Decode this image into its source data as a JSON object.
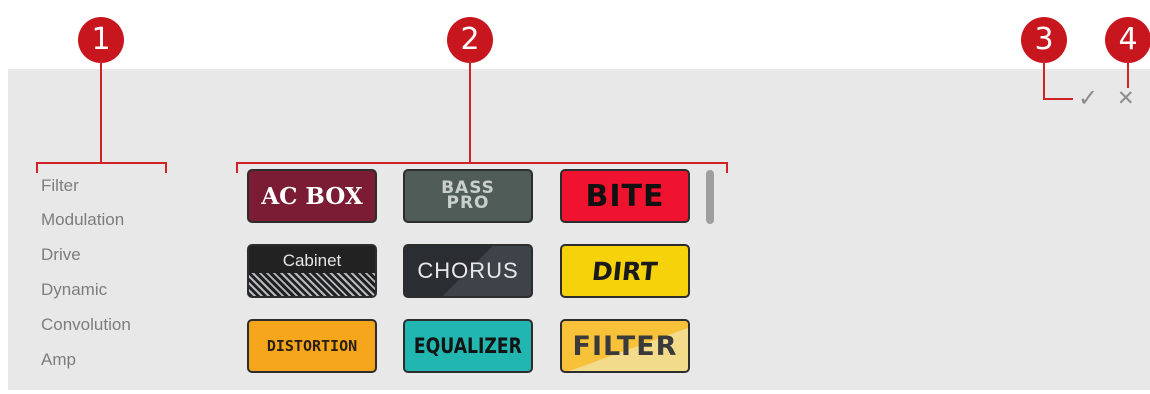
{
  "callouts": [
    "1",
    "2",
    "3",
    "4"
  ],
  "categories": [
    "Filter",
    "Modulation",
    "Drive",
    "Dynamic",
    "Convolution",
    "Amp"
  ],
  "tiles": [
    {
      "label": "AC BOX",
      "color": "#7b1c34"
    },
    {
      "label": "BASS PRO",
      "line1": "BASS",
      "line2": "PRO",
      "color": "#4f5c58"
    },
    {
      "label": "BITE",
      "color": "#ef1330"
    },
    {
      "label": "Cabinet",
      "color": "#222222"
    },
    {
      "label": "CHORUS",
      "color": "#2e3338"
    },
    {
      "label": "DIRT",
      "color": "#f5d20a"
    },
    {
      "label": "DISTORTION",
      "color": "#f6a61a"
    },
    {
      "label": "EQUALIZER",
      "color": "#21b6b0"
    },
    {
      "label": "FILTER",
      "color": "#f7c23a"
    }
  ],
  "controls": {
    "confirm_icon": "check-icon",
    "confirm": "✓",
    "close_icon": "close-icon",
    "close": "✕"
  },
  "accent": "#c8161e"
}
